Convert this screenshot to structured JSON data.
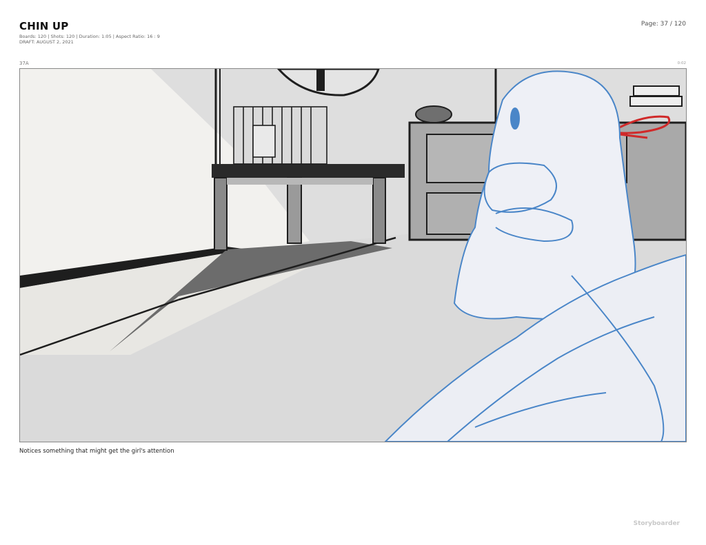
{
  "project": {
    "title": "CHIN UP",
    "meta_line1": "Boards: 120  |  Shots: 120  |  Duration: 1:05  |  Aspect Ratio: 16 : 9",
    "meta_line2": "DRAFT: AUGUST 2, 2021"
  },
  "page": {
    "number_label": "Page: 37 / 120"
  },
  "board": {
    "shot_number": "37A",
    "timecode": "0:02",
    "dialogue": "Notices something that might get the girl's attention"
  },
  "footer": {
    "brand": "Storyboarder"
  },
  "colors": {
    "sketch_blue": "#4a86c8",
    "sketch_red": "#d02a2a",
    "ink": "#1e1e1e"
  }
}
